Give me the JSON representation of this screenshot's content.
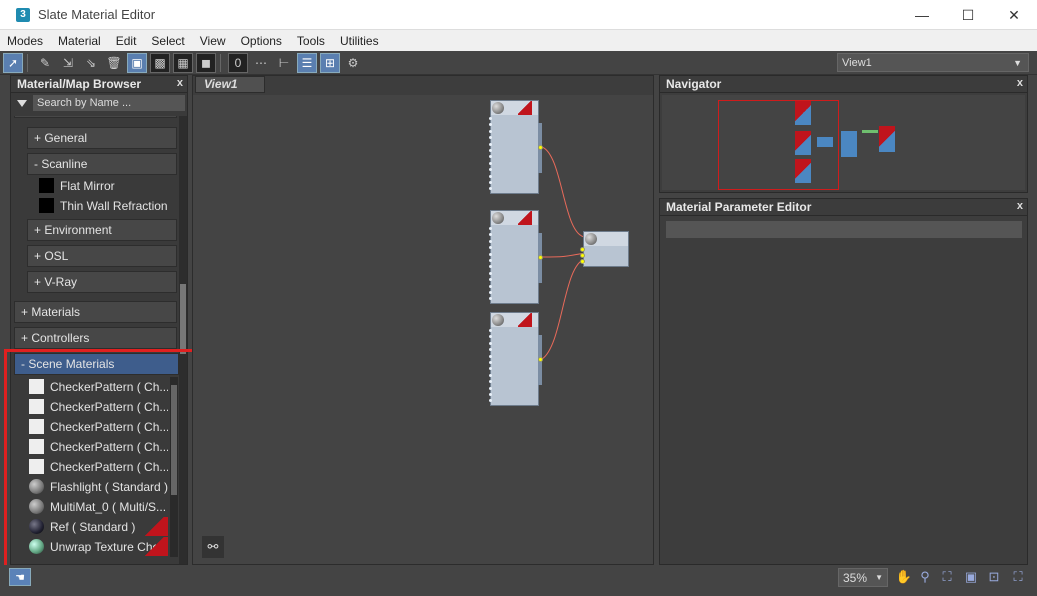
{
  "window": {
    "app_icon": "3",
    "title": "Slate Material Editor",
    "minimize": "—",
    "maximize": "☐",
    "close": "✕"
  },
  "menu": [
    "Modes",
    "Material",
    "Edit",
    "Select",
    "View",
    "Options",
    "Tools",
    "Utilities"
  ],
  "toolbar": {
    "view_selector": "View1"
  },
  "browser": {
    "title": "Material/Map Browser",
    "close": "x",
    "search_placeholder": "Search by Name ...",
    "groups": {
      "general": "+ General",
      "scanline": "- Scanline",
      "environment": "+ Environment",
      "osl": "+ OSL",
      "vray": "+ V-Ray",
      "materials": "+ Materials",
      "controllers": "+ Controllers",
      "scene_materials": "- Scene Materials"
    },
    "scanline_items": [
      "Flat Mirror",
      "Thin Wall Refraction"
    ],
    "scene_items": [
      "CheckerPattern  ( Ch...",
      "CheckerPattern  ( Ch...",
      "CheckerPattern  ( Ch...",
      "CheckerPattern  ( Ch...",
      "CheckerPattern  ( Ch...",
      "Flashlight  ( Standard )",
      "MultiMat_0  ( Multi/S...",
      "Ref  ( Standard )",
      "Unwrap Texture Chec..."
    ]
  },
  "view": {
    "tab": "View1"
  },
  "navigator": {
    "title": "Navigator",
    "close": "x"
  },
  "mpe": {
    "title": "Material Parameter Editor",
    "close": "x"
  },
  "status": {
    "zoom": "35%"
  },
  "colors": {
    "selection": "#3e5d8c",
    "highlight_box": "#e02020",
    "node_fill": "#b8c4d2",
    "wire": "#e86a5a"
  }
}
